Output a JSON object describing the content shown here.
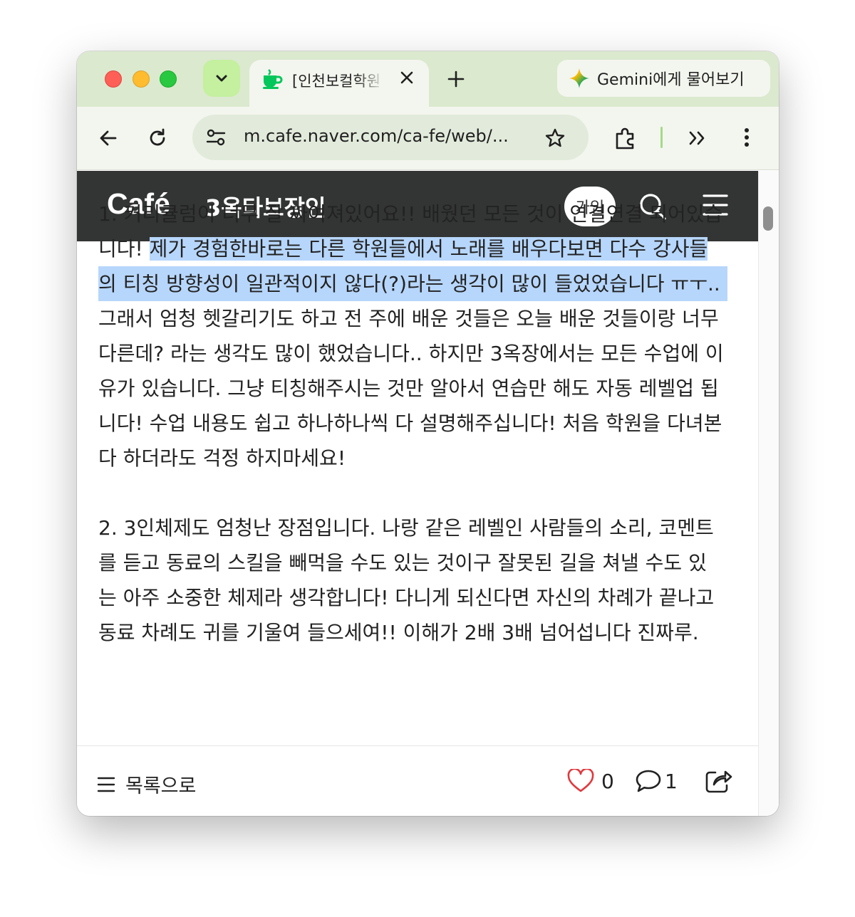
{
  "browser": {
    "tab": {
      "title": "[인천보컬학원"
    },
    "gemini_label": "Gemini에게 물어보기",
    "url": "m.cafe.naver.com/ca-fe/web/..."
  },
  "cafe": {
    "logo": "Café",
    "name": "3옥타브장인",
    "join_label": "가입"
  },
  "article": {
    "lines": [
      "1. 커리큘럼이 너무 잘 짜여져있어요!!  배웠던 모든 것이 연결연결 되어있습",
      "니다! ",
      "제가 경험한바로는 다른 학원들에서 노래를 배우다보면 다수 강사들",
      "의 티칭 방향성이 일관적이지 않다(?)라는 생각이 많이 들었었습니다 ㅠㅜ..",
      "그래서 엄청 헷갈리기도 하고 전 주에 배운 것들은 오늘 배운 것들이랑 너무",
      "다른데? 라는 생각도 많이 했었습니다.. 하지만 3옥장에서는 모든 수업에 이",
      "유가 있습니다. 그냥 티칭해주시는 것만 알아서 연습만 해도 자동 레벨업 됩",
      "니다! 수업 내용도 쉽고 하나하나씩 다 설명해주십니다! 처음 학원을 다녀본",
      "다 하더라도 걱정 하지마세요!",
      "2. 3인체제도 엄청난 장점입니다. 나랑 같은 레벨인 사람들의 소리, 코멘트",
      "를 듣고 동료의 스킬을 빼먹을 수도 있는 것이구 잘못된 길을 쳐낼 수도 있",
      "는 아주 소중한 체제라 생각합니다! 다니게 되신다면 자신의 차례가 끝나고",
      "동료 차례도 귀를 기울여 들으세여!! 이해가 2배 3배 넘어섭니다 진짜루."
    ]
  },
  "footer": {
    "list_label": "목록으로",
    "like_count": "0",
    "comment_count": "1"
  },
  "colors": {
    "tabstrip": "#dbe9cf",
    "toolbar": "#f3f6ee",
    "cafe_header": "#333535",
    "selection": "#b7d6fb",
    "like_heart": "#e0393e"
  }
}
